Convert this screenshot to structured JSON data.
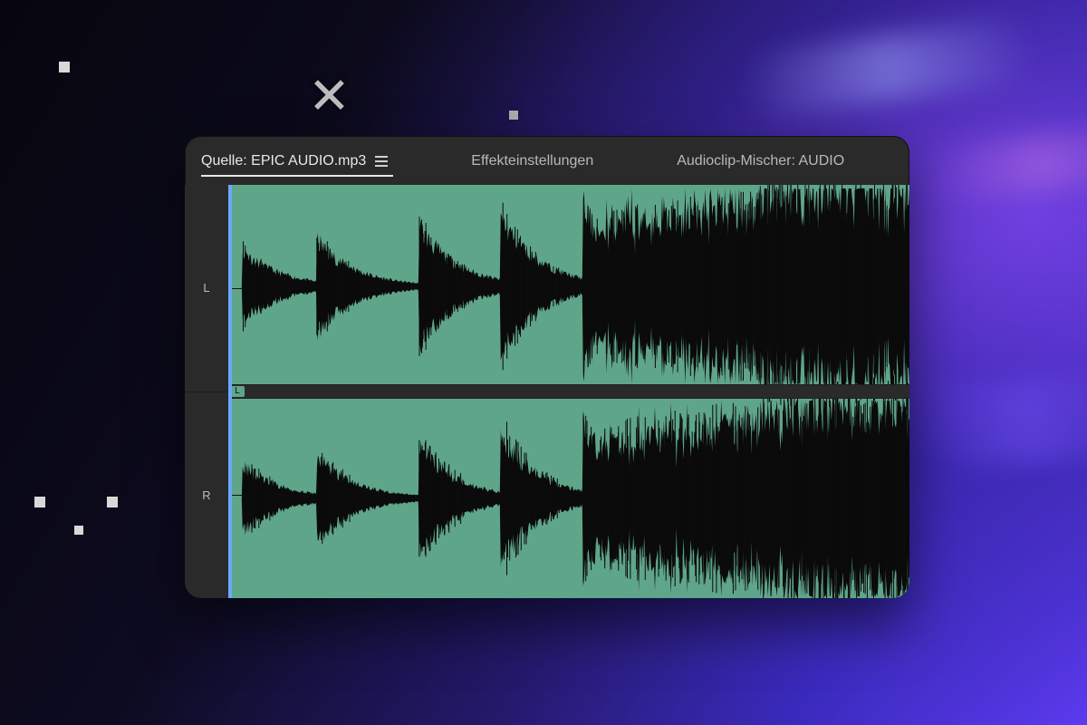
{
  "tabs": {
    "source": {
      "label": "Quelle: EPIC AUDIO.mp3"
    },
    "effects": {
      "label": "Effekteinstellungen"
    },
    "mixer": {
      "label": "Audioclip-Mischer: AUDIO"
    }
  },
  "channels": {
    "left": {
      "label": "L"
    },
    "right": {
      "label": "R"
    },
    "divider_badge": "L"
  },
  "decor": {
    "close_glyph": "✕"
  },
  "colors": {
    "waveform_bg": "#5fa58a",
    "waveform_fg": "#0b0b0b",
    "panel_bg": "#2a2a2a",
    "playhead": "#6aa7ff"
  }
}
